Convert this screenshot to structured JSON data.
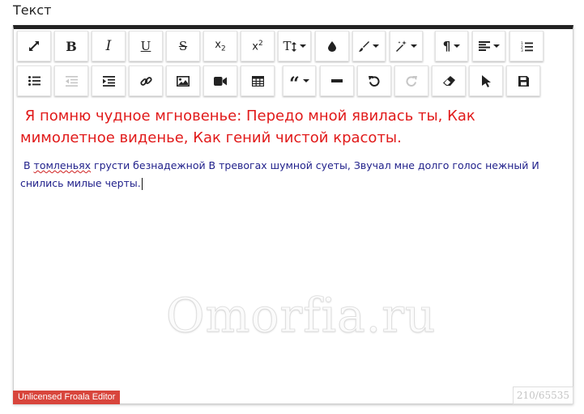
{
  "field_label": "Текст",
  "toolbar": {
    "row1": [
      {
        "name": "fullscreen-button",
        "icon": "expand-arrows-icon"
      },
      {
        "name": "bold-button",
        "icon": "bold-icon",
        "glyph": "B"
      },
      {
        "name": "italic-button",
        "icon": "italic-icon",
        "glyph": "I"
      },
      {
        "name": "underline-button",
        "icon": "underline-icon",
        "glyph": "U"
      },
      {
        "name": "strikethrough-button",
        "icon": "strikethrough-icon",
        "glyph": "S"
      },
      {
        "name": "subscript-button",
        "icon": "subscript-icon",
        "glyph": "x",
        "script": "2"
      },
      {
        "name": "superscript-button",
        "icon": "superscript-icon",
        "glyph": "x",
        "script": "2"
      },
      {
        "name": "font-size-button",
        "icon": "font-size-icon",
        "glyph": "T"
      },
      {
        "name": "text-color-button",
        "icon": "color-drop-icon"
      },
      {
        "name": "paragraph-style-button",
        "icon": "paint-brush-icon"
      },
      {
        "name": "inline-style-button",
        "icon": "magic-wand-icon"
      },
      {
        "name": "paragraph-format-button",
        "icon": "pilcrow-icon",
        "glyph": "¶"
      },
      {
        "name": "align-button",
        "icon": "align-left-icon"
      },
      {
        "name": "ordered-list-button",
        "icon": "ordered-list-icon"
      }
    ],
    "row2": [
      {
        "name": "unordered-list-button",
        "icon": "unordered-list-icon"
      },
      {
        "name": "outdent-button",
        "icon": "outdent-icon",
        "disabled": true
      },
      {
        "name": "indent-button",
        "icon": "indent-icon"
      },
      {
        "name": "insert-link-button",
        "icon": "link-icon"
      },
      {
        "name": "insert-image-button",
        "icon": "image-icon"
      },
      {
        "name": "insert-video-button",
        "icon": "video-camera-icon"
      },
      {
        "name": "insert-table-button",
        "icon": "table-icon"
      },
      {
        "name": "quote-button",
        "icon": "quote-icon",
        "glyph": "“"
      },
      {
        "name": "horizontal-line-button",
        "icon": "horizontal-line-icon"
      },
      {
        "name": "undo-button",
        "icon": "undo-icon"
      },
      {
        "name": "redo-button",
        "icon": "redo-icon",
        "disabled": true
      },
      {
        "name": "clear-formatting-button",
        "icon": "eraser-icon"
      },
      {
        "name": "select-all-button",
        "icon": "mouse-pointer-icon"
      },
      {
        "name": "save-button",
        "icon": "save-floppy-icon"
      }
    ]
  },
  "content": {
    "heading": "Я помню чудное мгновенье: Передо мной явилась ты, Как мимолетное виденье, Как гений чистой красоты.",
    "body_prefix": "В ",
    "body_misspelled": "томленьях",
    "body_suffix": " грусти безнадежной В тревогах шумной суеты, Звучал мне долго голос нежный И снились милые черты."
  },
  "watermark": "Omorfia.ru",
  "license_badge": "Unlicensed Froala Editor",
  "char_counter": "210/65535",
  "colors": {
    "heading_text": "#e11a1a",
    "body_text": "#1f1f8a",
    "toolbar_top_border": "#222222",
    "license_badge_bg": "#d8453c"
  }
}
